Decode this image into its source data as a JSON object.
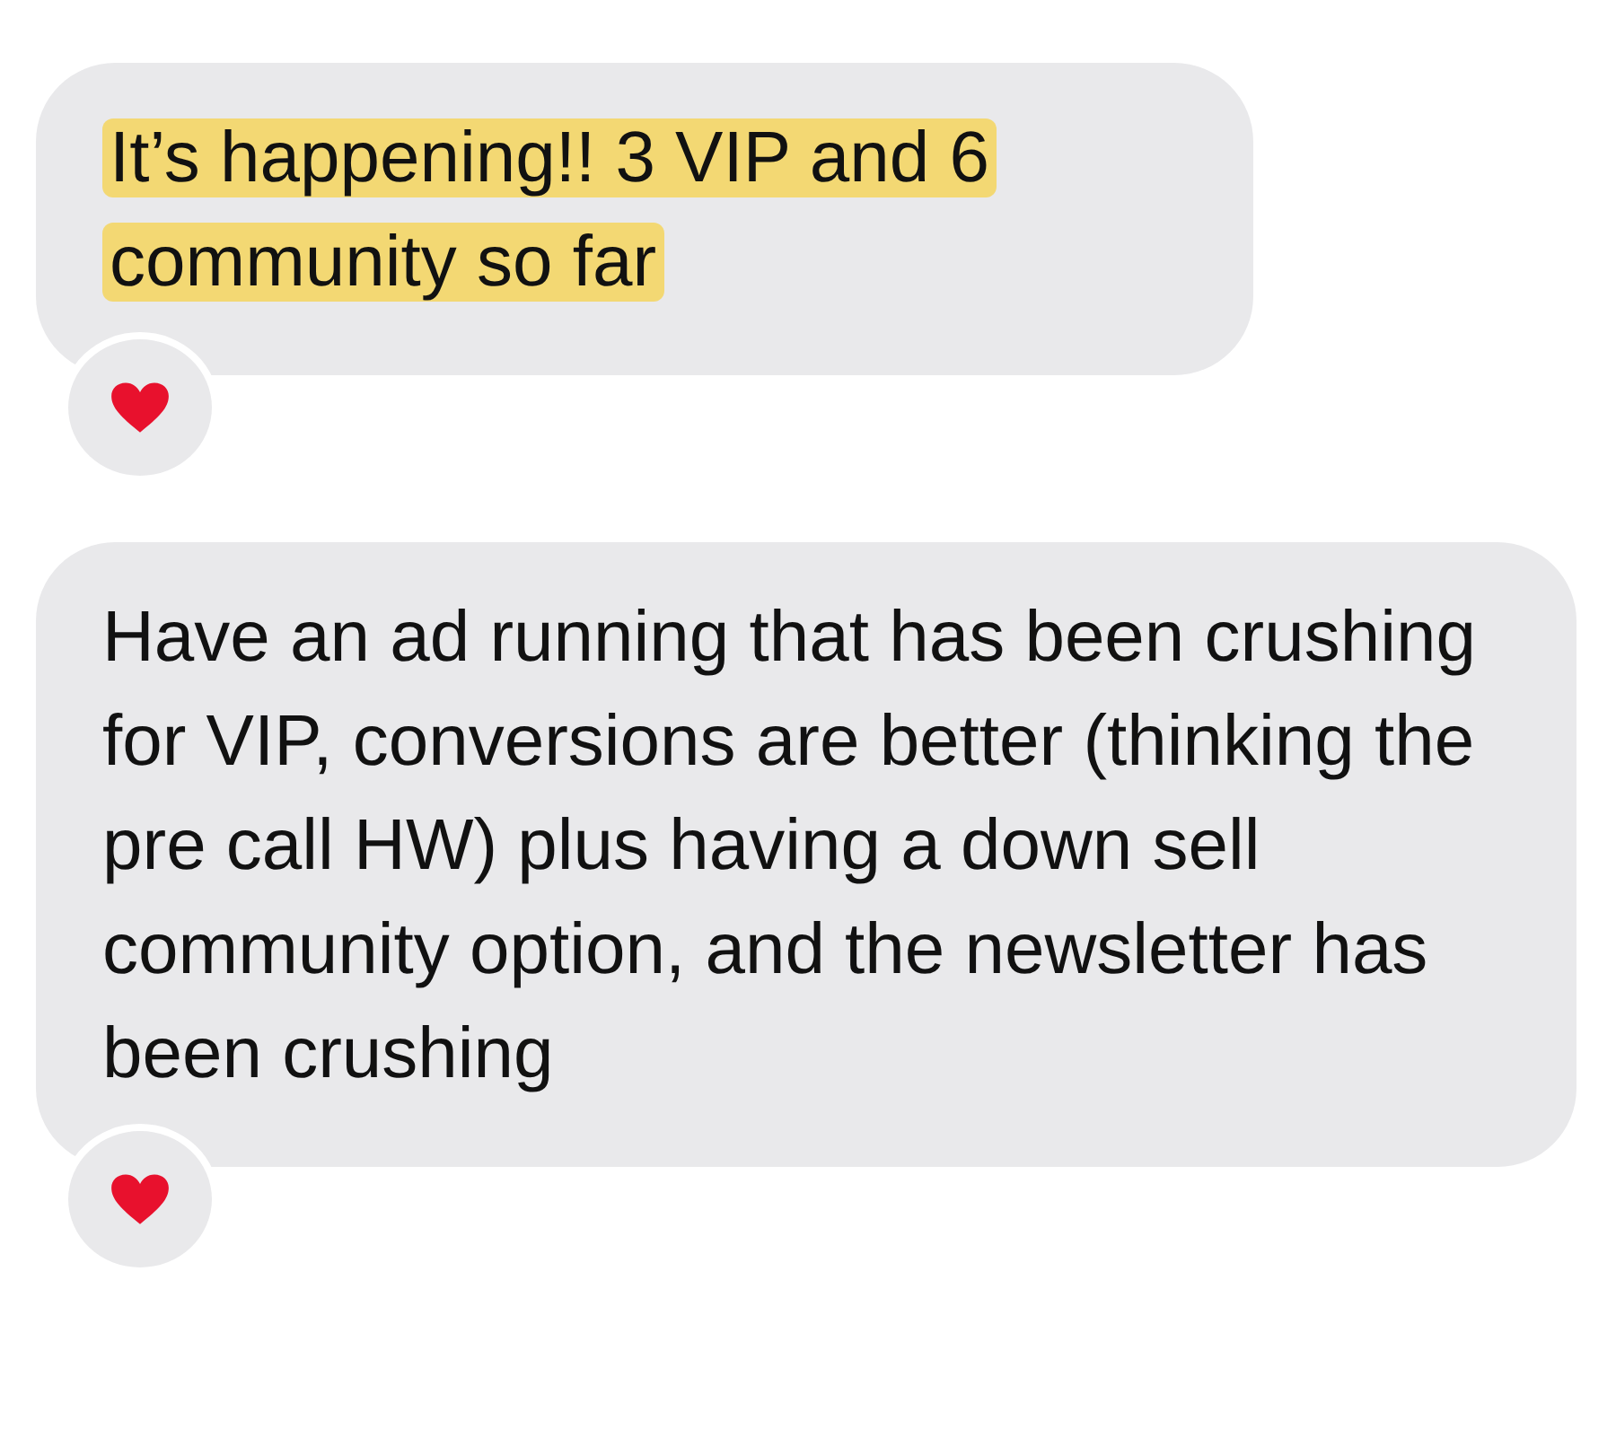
{
  "messages": [
    {
      "text": "It’s happening!! 3 VIP and 6 community so far",
      "highlighted": true,
      "reacted": true
    },
    {
      "text": "Have an ad running that has been crushing for VIP, conversions are better (thinking the pre call HW) plus having a down sell community option, and the newsletter has been crushing",
      "highlighted": false,
      "reacted": true
    }
  ]
}
